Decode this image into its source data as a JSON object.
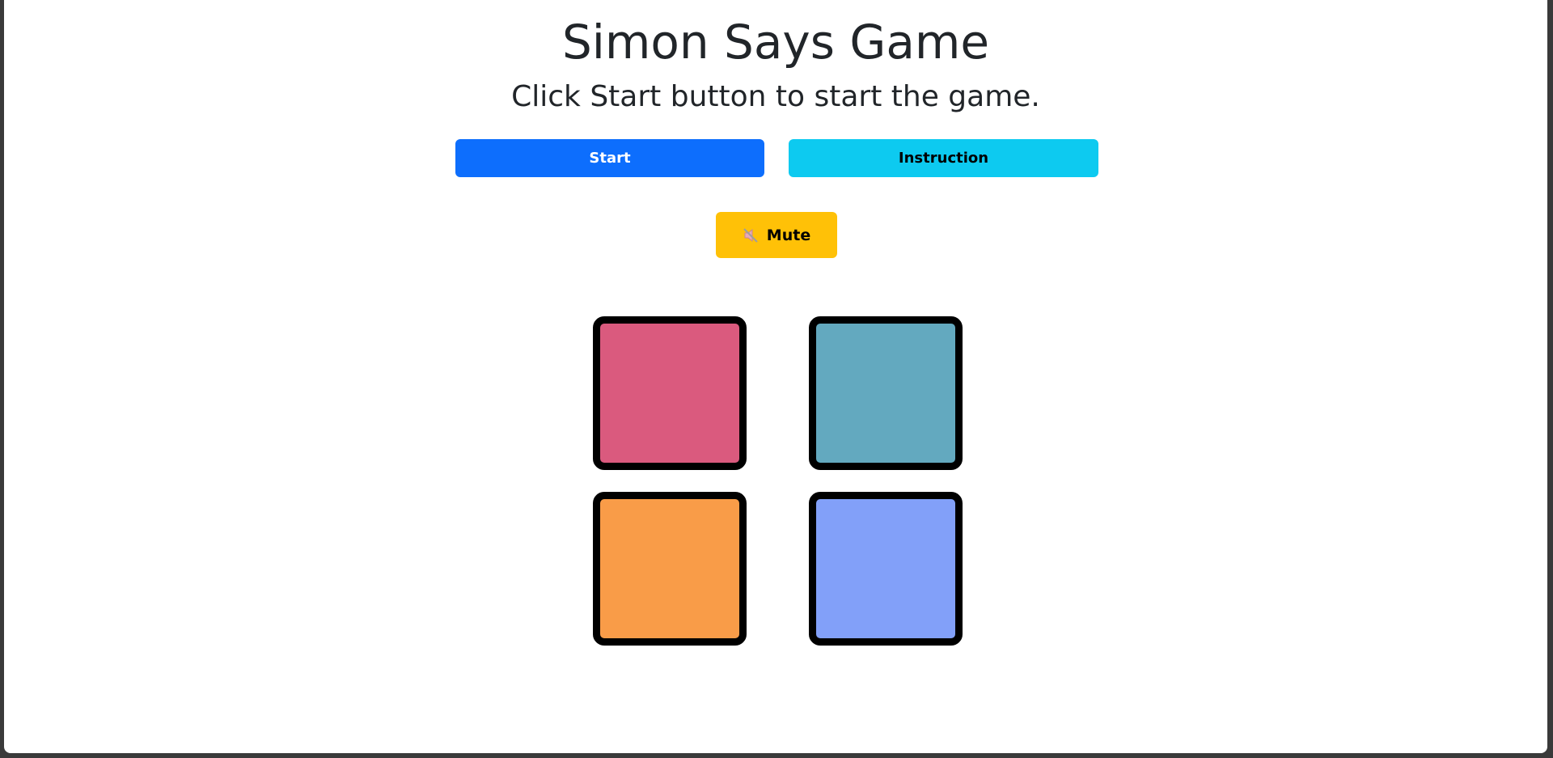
{
  "header": {
    "title": "Simon Says Game",
    "status": "Click Start button to start the game."
  },
  "controls": {
    "start_label": "Start",
    "instruction_label": "Instruction",
    "mute_label": "Mute",
    "mute_icon": "speaker-muted-icon"
  },
  "colors": {
    "start": "#0d6efd",
    "instruction": "#0dcaf0",
    "mute": "#ffc107"
  },
  "pads": [
    {
      "name": "red",
      "color": "#da5a7e"
    },
    {
      "name": "teal",
      "color": "#63a9bf"
    },
    {
      "name": "orange",
      "color": "#f99c48"
    },
    {
      "name": "blue",
      "color": "#82a0f9"
    }
  ]
}
